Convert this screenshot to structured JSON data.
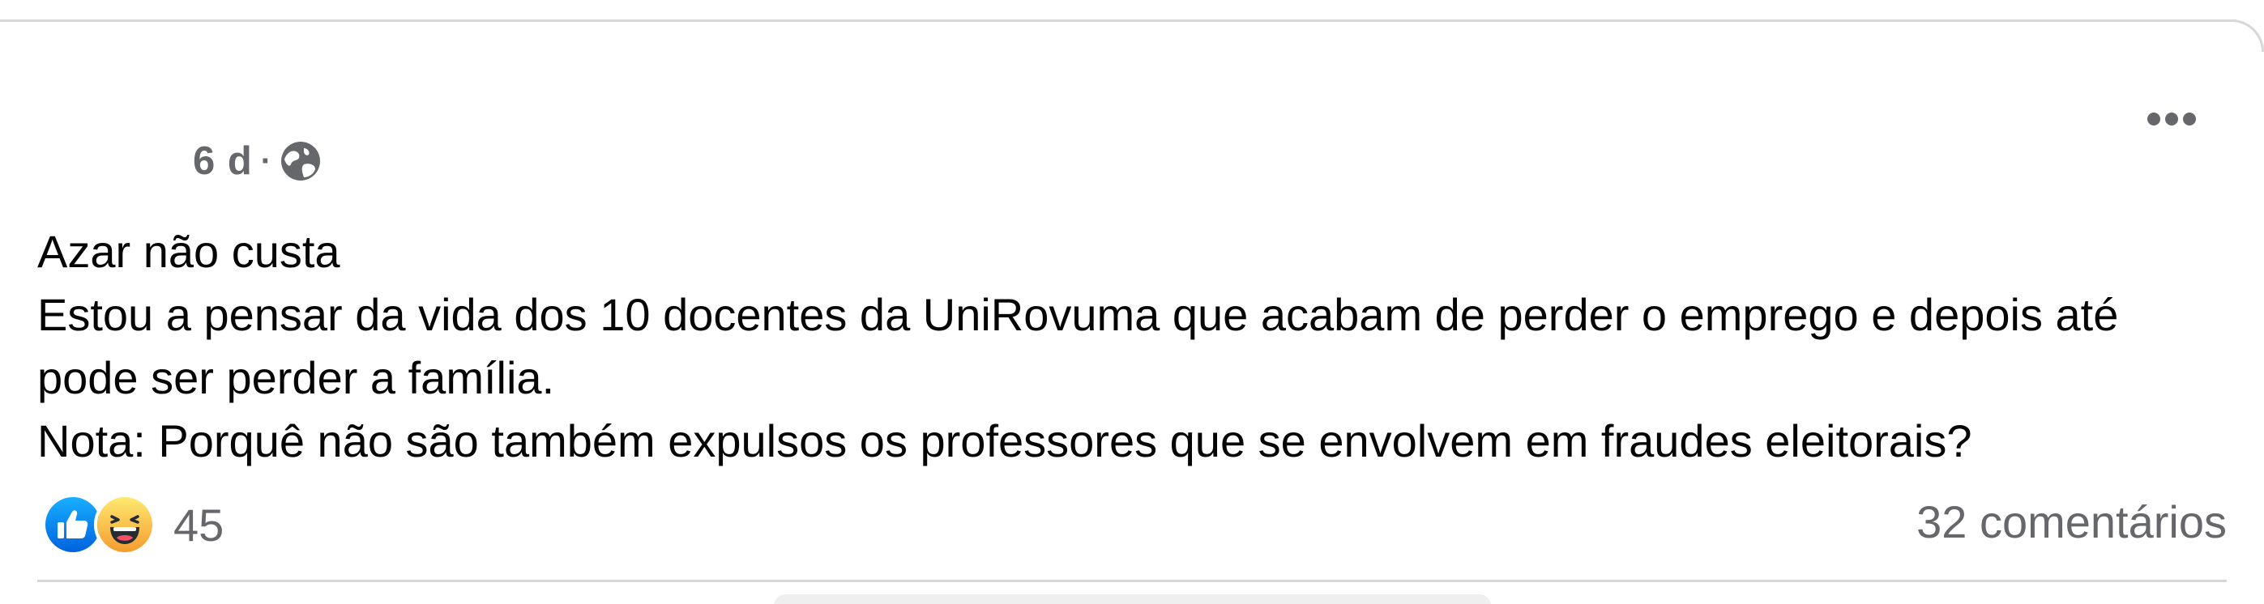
{
  "post": {
    "timestamp": "6 d",
    "separator": "·",
    "privacy_icon": "globe-icon",
    "more_icon": "more-horizontal-icon",
    "lines": [
      "Azar não custa",
      "Estou a pensar da vida dos 10 docentes da UniRovuma que acabam de perder o emprego e depois até",
      "pode ser perder a família.",
      "Nota: Porquê não são também expulsos os professores que se envolvem em fraudes eleitorais?"
    ]
  },
  "footer": {
    "reaction_icons": [
      "like-icon",
      "haha-icon"
    ],
    "reaction_count": "45",
    "comments_label": "32 comentários"
  },
  "colors": {
    "like_blue": "#1877f2",
    "haha_yellow": "#f7b125",
    "secondary_text": "#65676b",
    "primary_text": "#050505"
  }
}
